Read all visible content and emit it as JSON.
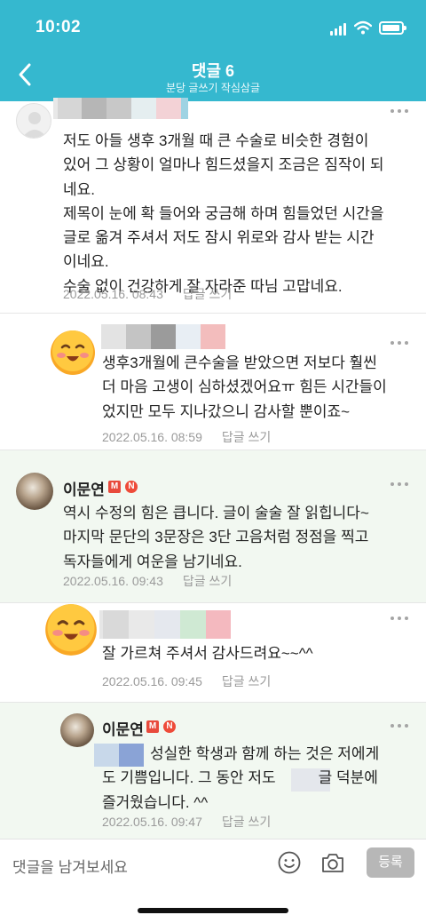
{
  "status_bar": {
    "time": "10:02"
  },
  "header": {
    "title": "댓글 6",
    "subtitle": "분당 글쓰기 작심삼글"
  },
  "comments": [
    {
      "author": "",
      "text": [
        "저도 아들 생후 3개월 때 큰 수술로 비슷한 경험이",
        "있어 그 상황이 얼마나 힘드셨을지 조금은 짐작이 되",
        "네요.",
        "제목이 눈에 확 들어와 궁금해 하며 힘들었던 시간을",
        "글로 옮겨 주셔서 저도 잠시 위로와 감사 받는 시간",
        "이네요.",
        "수술 없이 건강하게 잘 자라준 따님 고맙네요."
      ],
      "date": "2022.05.16. 08:43",
      "reply_label": "답글 쓰기"
    },
    {
      "author": "",
      "text": [
        "생후3개월에 큰수술을 받았으면 저보다 훨씬",
        "더 마음 고생이 심하셨겠어요ㅠ 힘든 시간들이",
        "었지만 모두 지나갔으니 감사할 뿐이죠~"
      ],
      "date": "2022.05.16. 08:59",
      "reply_label": "답글 쓰기"
    },
    {
      "author": "이문연",
      "badges": [
        "M",
        "N"
      ],
      "text": [
        "역시 수정의 힘은 큽니다. 글이 술술 잘 읽힙니다~",
        "마지막 문단의 3문장은 3단 고음처럼 정점을 찍고",
        "독자들에게 여운을 남기네요."
      ],
      "date": "2022.05.16. 09:43",
      "reply_label": "답글 쓰기"
    },
    {
      "author": "",
      "text": [
        "잘 가르쳐 주셔서 감사드려요~~^^"
      ],
      "date": "2022.05.16. 09:45",
      "reply_label": "답글 쓰기"
    },
    {
      "author": "이문연",
      "badges": [
        "M",
        "N"
      ],
      "text": [
        "성실한 학생과 함께 하는 것은 저에게",
        "도 기쁨입니다. 그 동안 저도",
        "글 덕분에",
        "즐거웠습니다. ^^"
      ],
      "date": "2022.05.16. 09:47",
      "reply_label": "답글 쓰기"
    }
  ],
  "comment_input": {
    "placeholder": "댓글을 남겨보세요",
    "submit_label": "등록"
  },
  "icons": [
    "back-arrow-icon",
    "more-dots-icon",
    "emoji-icon",
    "camera-icon",
    "signal-icon",
    "wifi-icon",
    "battery-icon"
  ],
  "colors": {
    "header": "#35b8cf",
    "highlight_bg": "#f2f8f1",
    "badge_red": "#e84a3c",
    "meta_gray": "#9a9a9a",
    "submit_bg": "#b7b7b7"
  }
}
